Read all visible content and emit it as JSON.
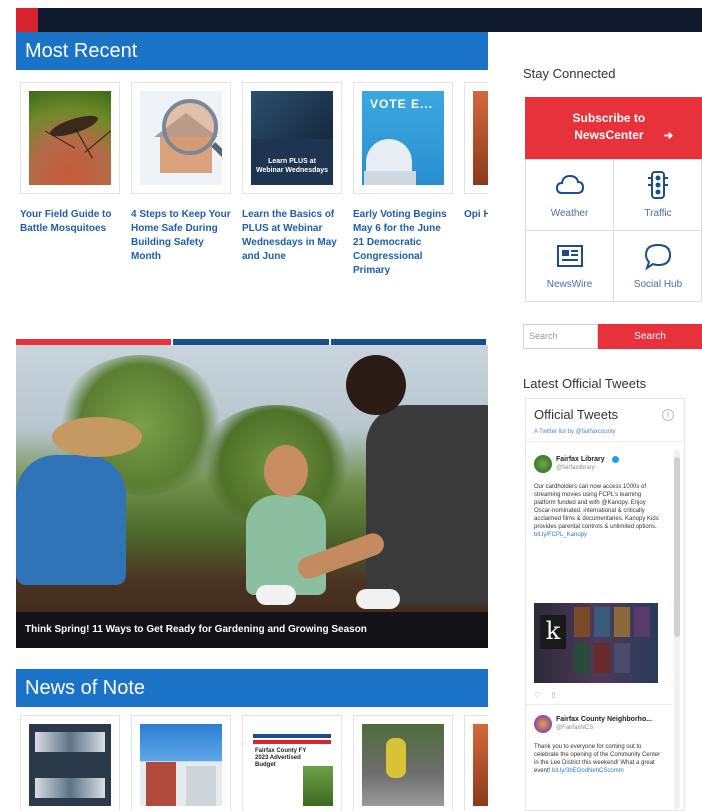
{
  "most_recent": {
    "heading": "Most Recent",
    "cards": [
      {
        "title": "Your Field Guide to Battle Mosquitoes"
      },
      {
        "title": "4 Steps to Keep Your Home Safe During Building Safety Month"
      },
      {
        "title": "Learn the Basics of PLUS at Webinar Wednesdays in May and June",
        "thumb_caption": "Learn PLUS at Webinar Wednesdays"
      },
      {
        "title": "Early Voting Begins May 6 for the June 21 Democratic Congressional Primary",
        "thumb_caption": "VOTE E..."
      },
      {
        "title": "Opi Hou and Ove"
      }
    ]
  },
  "hero": {
    "caption": "Think Spring! 11 Ways to Get Ready for Gardening and Growing Season",
    "strip_colors": [
      "#e8323b",
      "#1a4d8c",
      "#1a4d8c",
      "#1a4d8c"
    ]
  },
  "news_of_note": {
    "heading": "News of Note",
    "cards": [
      {
        "title": ""
      },
      {
        "title": ""
      },
      {
        "title": "",
        "thumb_caption": "Fairfax County FY 2023 Advertised Budget"
      },
      {
        "title": ""
      },
      {
        "title": ""
      }
    ]
  },
  "sidebar": {
    "stay_connected": "Stay Connected",
    "subscribe": "Subscribe to NewsCenter",
    "grid": [
      {
        "label": "Weather",
        "icon": "cloud-icon"
      },
      {
        "label": "Traffic",
        "icon": "traffic-light-icon"
      },
      {
        "label": "NewsWire",
        "icon": "newspaper-icon"
      },
      {
        "label": "Social Hub",
        "icon": "speech-bubble-icon"
      }
    ],
    "search_placeholder": "Search",
    "search_button": "Search",
    "tweets_heading": "Latest Official Tweets",
    "tweets_panel_title": "Official Tweets",
    "tweets_panel_sub": "A Twitter list by @fairfaxcounty",
    "tweets": [
      {
        "name": "Fairfax Library",
        "handle": "@fairfaxlibrary",
        "body": "Our cardholders can now access 1000s of streaming movies using FCPL's learning platform funded and with @Kanopy. Enjoy Oscar-nominated, international & critically acclaimed films & documentaries. Kanopy Kids provides parental controls & unlimited options.",
        "link": "bit.ly/FCPL_Kanopy"
      },
      {
        "name": "Fairfax County Neighborho...",
        "handle": "@FairfaxNCS",
        "body": "Thank you to everyone for coming out to celebrate the opening of the Community Center in the Lee District this weekend! What a great event!",
        "link": "bit.ly/3bEGodNehCScomm"
      }
    ]
  },
  "colors": {
    "brand_blue": "#1a73c6",
    "accent_red": "#e8323b",
    "navy": "#0f1a2e",
    "link_blue": "#1c5fa8"
  }
}
